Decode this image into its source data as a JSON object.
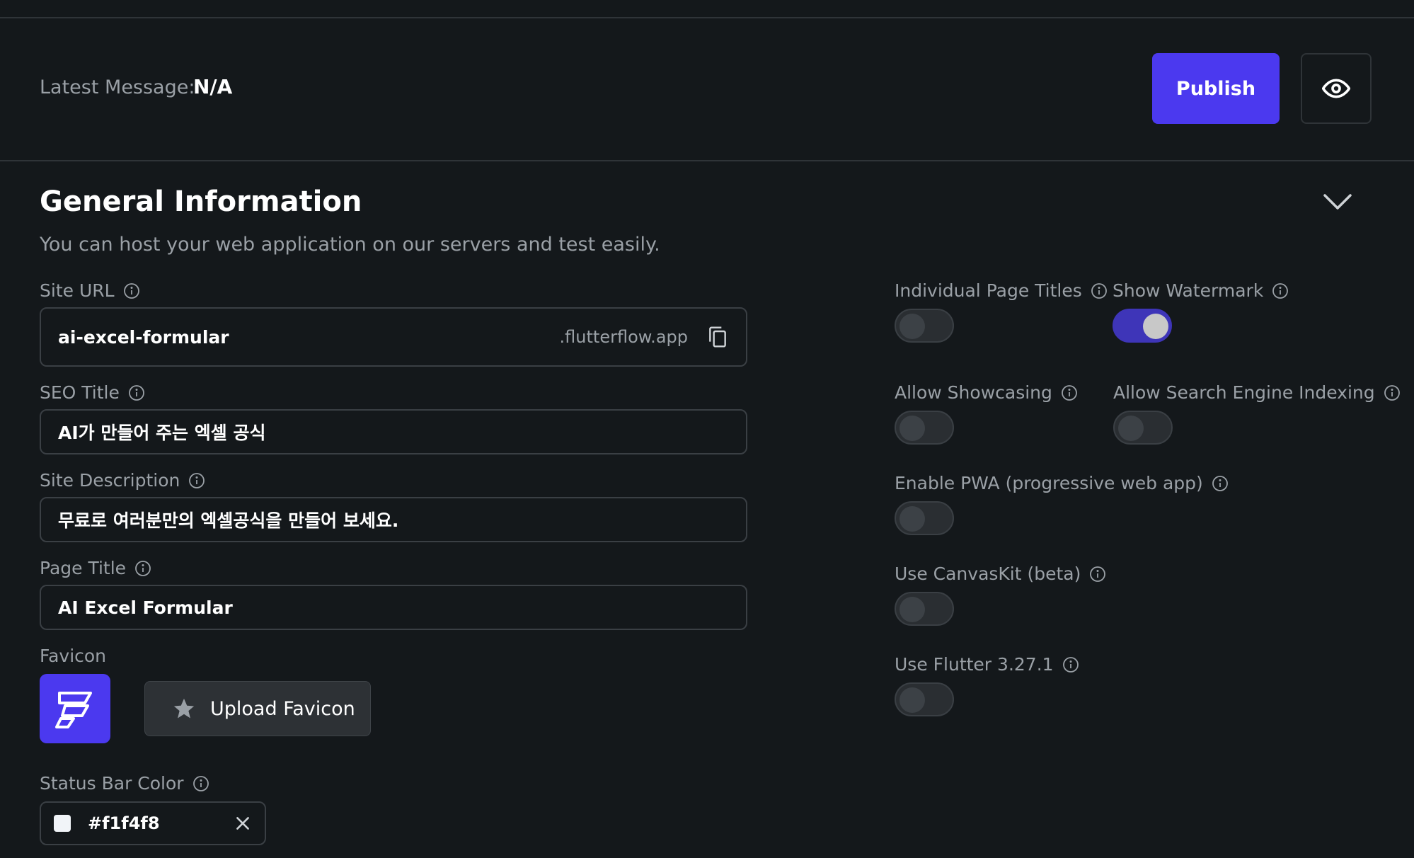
{
  "header": {
    "latest_message_label": "Latest Message:",
    "latest_message_value": "N/A",
    "publish_label": "Publish"
  },
  "section": {
    "title": "General Information",
    "subtitle": "You can host your web application on our servers and test easily."
  },
  "fields": {
    "site_url": {
      "label": "Site URL",
      "value": "ai-excel-formular",
      "suffix": ".flutterflow.app"
    },
    "seo_title": {
      "label": "SEO Title",
      "value": "AI가 만들어 주는 엑셀 공식"
    },
    "site_description": {
      "label": "Site Description",
      "value": "무료로 여러분만의 엑셀공식을 만들어 보세요."
    },
    "page_title": {
      "label": "Page Title",
      "value": "AI Excel Formular"
    },
    "favicon": {
      "label": "Favicon",
      "upload_label": "Upload Favicon"
    },
    "status_bar_color": {
      "label": "Status Bar Color",
      "value": "#f1f4f8"
    }
  },
  "toggles": {
    "individual_page_titles": {
      "label": "Individual Page Titles",
      "on": false
    },
    "show_watermark": {
      "label": "Show Watermark",
      "on": true
    },
    "allow_showcasing": {
      "label": "Allow Showcasing",
      "on": false
    },
    "allow_search_engine_indexing": {
      "label": "Allow Search Engine Indexing",
      "on": false
    },
    "enable_pwa": {
      "label": "Enable PWA (progressive web app)",
      "on": false
    },
    "use_canvaskit": {
      "label": "Use CanvasKit (beta)",
      "on": false
    },
    "use_flutter": {
      "label": "Use Flutter 3.27.1",
      "on": false
    }
  },
  "colors": {
    "background": "#14181b",
    "accent": "#4b39ef",
    "secondary_text": "#9aa0a6",
    "border": "#3a3f44"
  },
  "icons": [
    "eye-icon",
    "chevron-down-icon",
    "info-icon",
    "copy-icon",
    "star-icon",
    "close-icon",
    "flutterflow-logo-icon"
  ]
}
